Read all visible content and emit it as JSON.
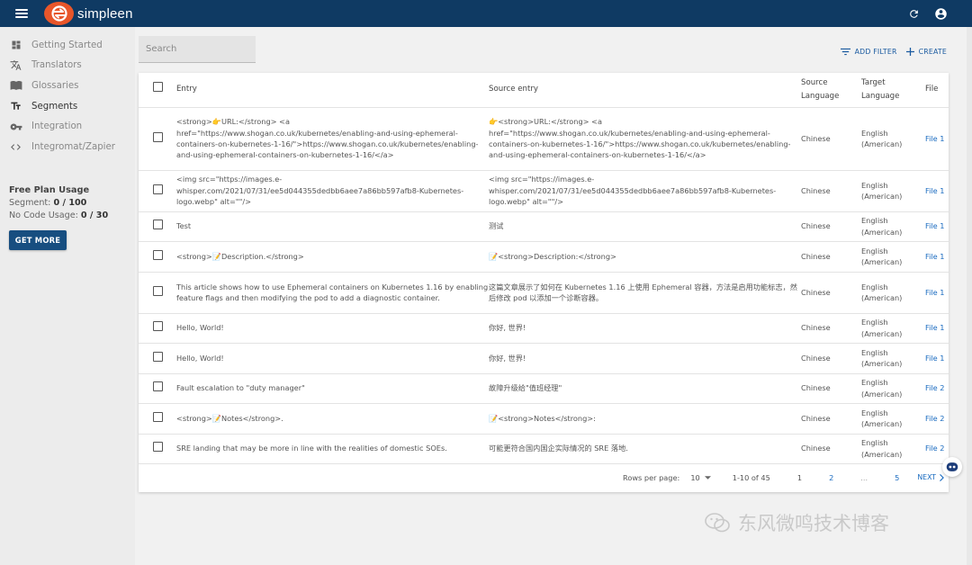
{
  "app": {
    "name": "simpleen"
  },
  "sidebar": {
    "items": [
      {
        "label": "Getting Started",
        "icon": "dashboard-icon"
      },
      {
        "label": "Translators",
        "icon": "translate-icon"
      },
      {
        "label": "Glossaries",
        "icon": "book-icon"
      },
      {
        "label": "Segments",
        "icon": "text-fields-icon",
        "active": true
      },
      {
        "label": "Integration",
        "icon": "key-icon"
      },
      {
        "label": "Integromat/Zapier",
        "icon": "code-icon"
      }
    ],
    "usage": {
      "title": "Free Plan Usage",
      "segment_label": "Segment:",
      "segment_value": "0 / 100",
      "nocode_label": "No Code Usage:",
      "nocode_value": "0 / 30"
    },
    "get_more": "GET MORE"
  },
  "search": {
    "placeholder": "Search"
  },
  "toolbar": {
    "add_filter": "ADD FILTER",
    "create": "CREATE"
  },
  "table": {
    "headers": {
      "entry": "Entry",
      "source_entry": "Source entry",
      "source_language": "Source Language",
      "target_language": "Target Language",
      "file": "File"
    },
    "rows": [
      {
        "entry": "<strong>👉URL:</strong> <a href=\"https://www.shogan.co.uk/kubernetes/enabling-and-using-ephemeral-containers-on-kubernetes-1-16/\">https://www.shogan.co.uk/kubernetes/enabling-and-using-ephemeral-containers-on-kubernetes-1-16/</a>",
        "source": "👉<strong>URL:</strong> <a href=\"https://www.shogan.co.uk/kubernetes/enabling-and-using-ephemeral-containers-on-kubernetes-1-16/\">https://www.shogan.co.uk/kubernetes/enabling-and-using-ephemeral-containers-on-kubernetes-1-16/</a>",
        "source_language": "Chinese",
        "target_language": "English (American)",
        "file": "File 1"
      },
      {
        "entry": "<img src=\"https://images.e-whisper.com/2021/07/31/ee5d044355dedbb6aee7a86bb597afb8-Kubernetes-logo.webp\" alt=\"\"/>",
        "source": "<img src=\"https://images.e-whisper.com/2021/07/31/ee5d044355dedbb6aee7a86bb597afb8-Kubernetes-logo.webp\" alt=\"\"/>",
        "source_language": "Chinese",
        "target_language": "English (American)",
        "file": "File 1"
      },
      {
        "entry": "Test",
        "source": "测试",
        "source_language": "Chinese",
        "target_language": "English (American)",
        "file": "File 1"
      },
      {
        "entry": "<strong>📝Description.</strong>",
        "source": "📝<strong>Description:</strong>",
        "source_language": "Chinese",
        "target_language": "English (American)",
        "file": "File 1"
      },
      {
        "entry": "This article shows how to use Ephemeral containers on Kubernetes 1.16 by enabling feature flags and then modifying the pod to add a diagnostic container.",
        "source": "这篇文章展示了如何在 Kubernetes 1.16 上使用 Ephemeral 容器，方法是启用功能标志，然后修改 pod 以添加一个诊断容器。",
        "source_language": "Chinese",
        "target_language": "English (American)",
        "file": "File 1"
      },
      {
        "entry": "Hello, World!",
        "source": "你好, 世界!",
        "source_language": "Chinese",
        "target_language": "English (American)",
        "file": "File 1"
      },
      {
        "entry": "Hello, World!",
        "source": "你好, 世界!",
        "source_language": "Chinese",
        "target_language": "English (American)",
        "file": "File 1"
      },
      {
        "entry": "Fault escalation to \"duty manager\"",
        "source": "故障升级给\"值班经理\"",
        "source_language": "Chinese",
        "target_language": "English (American)",
        "file": "File 2"
      },
      {
        "entry": "<strong>📝Notes</strong>.",
        "source": "📝<strong>Notes</strong>:",
        "source_language": "Chinese",
        "target_language": "English (American)",
        "file": "File 2"
      },
      {
        "entry": "SRE landing that may be more in line with the realities of domestic SOEs.",
        "source": "可能更符合国内国企实际情况的 SRE 落地.",
        "source_language": "Chinese",
        "target_language": "English (American)",
        "file": "File 2"
      }
    ]
  },
  "pagination": {
    "rows_per_page_label": "Rows per page:",
    "rows_per_page": "10",
    "range": "1-10 of 45",
    "pages": [
      "1",
      "2",
      "...",
      "5"
    ],
    "next": "NEXT"
  },
  "watermark": "东风微鸣技术博客"
}
